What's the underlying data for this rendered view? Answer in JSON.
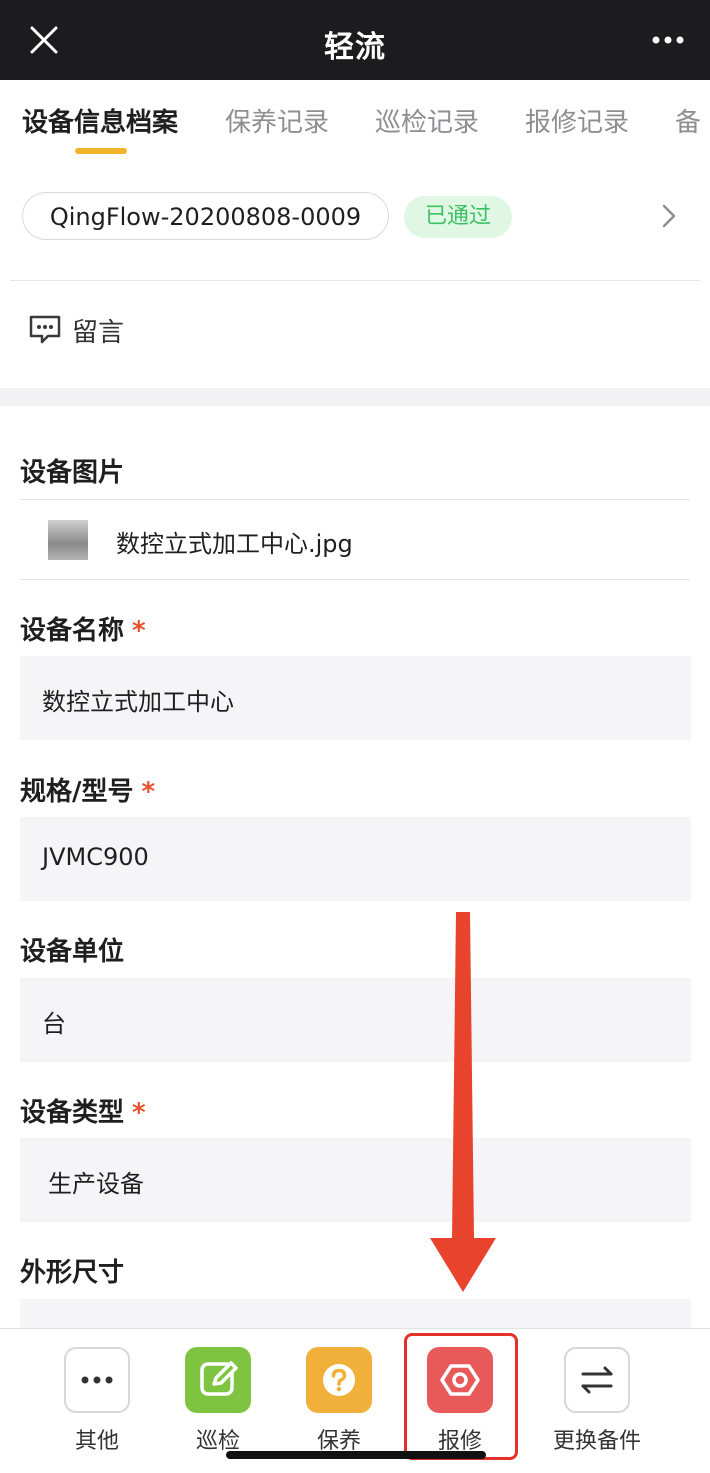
{
  "header": {
    "title": "轻流"
  },
  "tabs": [
    {
      "label": "设备信息档案",
      "active": true
    },
    {
      "label": "保养记录",
      "active": false
    },
    {
      "label": "巡检记录",
      "active": false
    },
    {
      "label": "报修记录",
      "active": false
    },
    {
      "label": "备",
      "active": false
    }
  ],
  "record": {
    "id": "QingFlow-20200808-0009",
    "status": "已通过",
    "status_color": "#3cc265"
  },
  "comment": {
    "label": "留言"
  },
  "form": {
    "image_field": {
      "label": "设备图片",
      "file_name": "数控立式加工中心.jpg"
    },
    "fields": [
      {
        "label": "设备名称",
        "required_mark": "*",
        "value": "数控立式加工中心"
      },
      {
        "label": "规格/型号",
        "required_mark": "*",
        "value": "JVMC900"
      },
      {
        "label": "设备单位",
        "required_mark": "",
        "value": "台"
      },
      {
        "label": "设备类型",
        "required_mark": "*",
        "value": "生产设备"
      },
      {
        "label": "外形尺寸",
        "required_mark": "",
        "value": ""
      }
    ]
  },
  "bottom_bar": [
    {
      "label": "其他",
      "icon": "more-dots-icon",
      "color": "#ffffff"
    },
    {
      "label": "巡检",
      "icon": "edit-icon",
      "color": "#7ec441"
    },
    {
      "label": "保养",
      "icon": "question-icon",
      "color": "#f0b03a"
    },
    {
      "label": "报修",
      "icon": "hexagon-nut-icon",
      "color": "#e85a5a"
    },
    {
      "label": "更换备件",
      "icon": "swap-arrows-icon",
      "color": "#ffffff"
    }
  ],
  "annotation_color": "#e3322b"
}
